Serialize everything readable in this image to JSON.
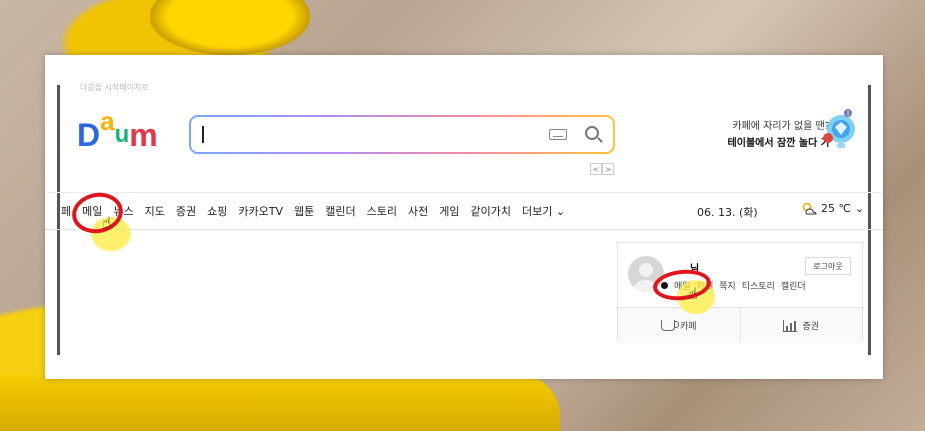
{
  "header": {
    "top_faded_text": "다음을 시작페이지로",
    "logo": [
      "D",
      "a",
      "u",
      "m"
    ],
    "search": {
      "placeholder": ""
    },
    "pager": [
      "<",
      ">"
    ]
  },
  "ad": {
    "line1": "카페에 자리가 없을 땐?",
    "line2": "테이블에서 잠깐 놀다 가"
  },
  "nav": {
    "items": [
      "페",
      "메일",
      "뉴스",
      "지도",
      "증권",
      "쇼핑",
      "카카오TV",
      "웹툰",
      "캘린더",
      "스토리",
      "사전",
      "게임",
      "같이가치",
      "더보기"
    ],
    "more_arrow": "⌄",
    "date": "06. 13. (화)",
    "weather": "25 ℃",
    "weather_arrow": "⌄"
  },
  "user": {
    "name": "님",
    "logout": "로그아웃",
    "links": [
      "메일",
      "카페",
      "쪽지",
      "티스토리",
      "캘린더"
    ],
    "bottom": [
      {
        "label": "카페",
        "icon": "cup-icon"
      },
      {
        "label": "증권",
        "icon": "bars-icon"
      }
    ]
  },
  "colors": {
    "logo_d": "#2b66e8",
    "logo_a": "#f6b400",
    "logo_u": "#19b47a",
    "logo_m": "#e9334b",
    "highlight_ring": "#e2141e"
  }
}
